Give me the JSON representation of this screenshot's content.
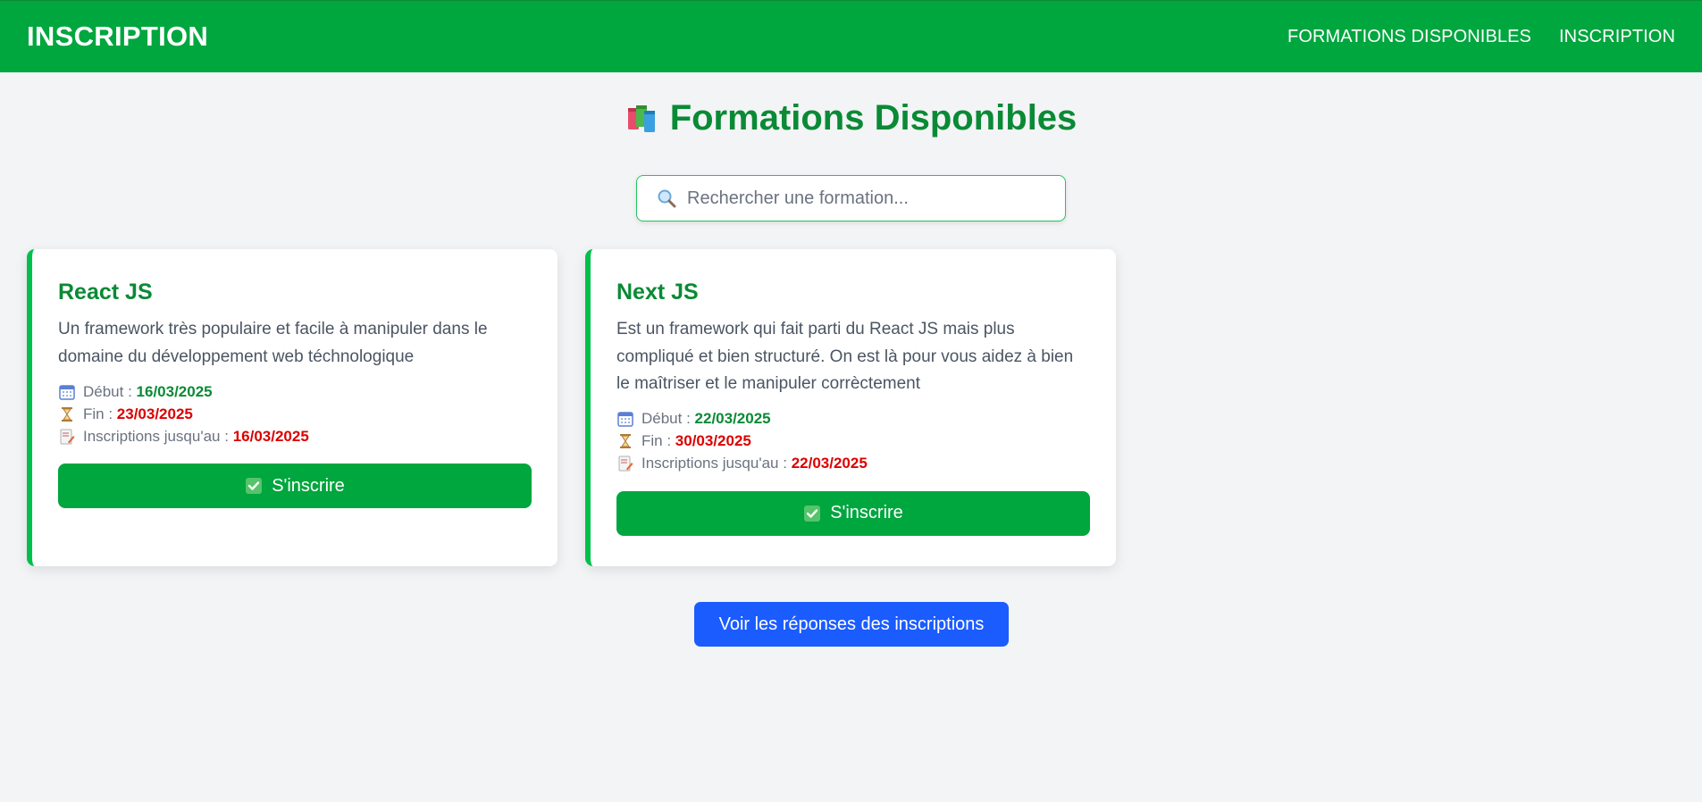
{
  "navbar": {
    "brand": "INSCRIPTION",
    "links": [
      "FORMATIONS DISPONIBLES",
      "INSCRIPTION"
    ],
    "color": "#00a63e"
  },
  "page": {
    "title": "Formations Disponibles",
    "title_icon": "books-icon",
    "title_color": "#0a8a35"
  },
  "search": {
    "placeholder": "Rechercher une formation...",
    "value": "",
    "icon": "magnifier-icon"
  },
  "formations": [
    {
      "title": "React JS",
      "description": "Un framework très populaire et facile à manipuler dans le domaine du développement web téchnologique",
      "debut_label": "Début :",
      "debut": "16/03/2025",
      "fin_label": "Fin :",
      "fin": "23/03/2025",
      "limite_label": "Inscriptions jusqu'au :",
      "limite": "16/03/2025",
      "button": "S'inscrire"
    },
    {
      "title": "Next JS",
      "description": "Est un framework qui fait parti du React JS mais plus compliqué et bien structuré. On est là pour vous aidez à bien le maîtriser et le manipuler corrèctement",
      "debut_label": "Début :",
      "debut": "22/03/2025",
      "fin_label": "Fin :",
      "fin": "30/03/2025",
      "limite_label": "Inscriptions jusqu'au :",
      "limite": "22/03/2025",
      "button": "S'inscrire"
    }
  ],
  "responses_button": "Voir les réponses des inscriptions",
  "colors": {
    "primary_green": "#00a63e",
    "accent_green": "#0a8a35",
    "date_red": "#dc0000",
    "blue_button": "#1b5cff",
    "background": "#f3f4f6"
  }
}
